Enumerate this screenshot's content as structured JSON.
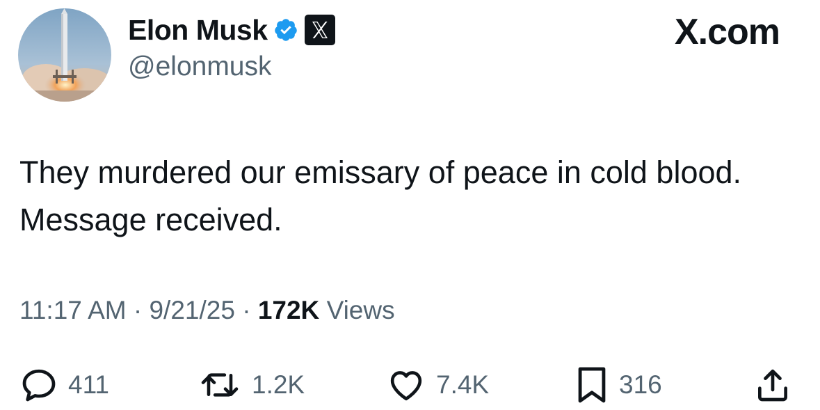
{
  "header": {
    "display_name": "Elon Musk",
    "handle": "@elonmusk",
    "brand": "X.com",
    "verified_icon": "verified-badge-icon",
    "affiliate_icon": "x-logo-icon"
  },
  "tweet": {
    "text": "They murdered our emissary of peace in cold blood. Message received."
  },
  "meta": {
    "time": "11:17 AM",
    "separator": "·",
    "date": "9/21/25",
    "views_count": "172K",
    "views_label": "Views"
  },
  "actions": {
    "replies": "411",
    "reposts": "1.2K",
    "likes": "7.4K",
    "bookmarks": "316"
  },
  "colors": {
    "text": "#0f1419",
    "secondary": "#536471",
    "verified": "#1d9bf0"
  }
}
